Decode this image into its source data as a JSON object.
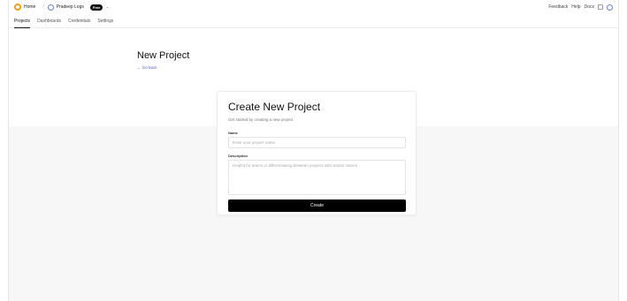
{
  "topbar": {
    "home_label": "Home",
    "org_label": "Pradeep Logs",
    "org_badge": "Free",
    "links": [
      "Feedback",
      "Help",
      "Docs"
    ]
  },
  "tabs": [
    "Projects",
    "Dashboards",
    "Credentials",
    "Settings"
  ],
  "page": {
    "title": "New Project",
    "go_back": "← Go back"
  },
  "form": {
    "title": "Create New Project",
    "subtitle": "Get started by creating a new project",
    "name_label": "Name",
    "name_placeholder": "Enter your project name",
    "description_label": "Description",
    "description_placeholder": "Helpful for teams or differentiating between projects with similar names",
    "submit_label": "Create"
  }
}
